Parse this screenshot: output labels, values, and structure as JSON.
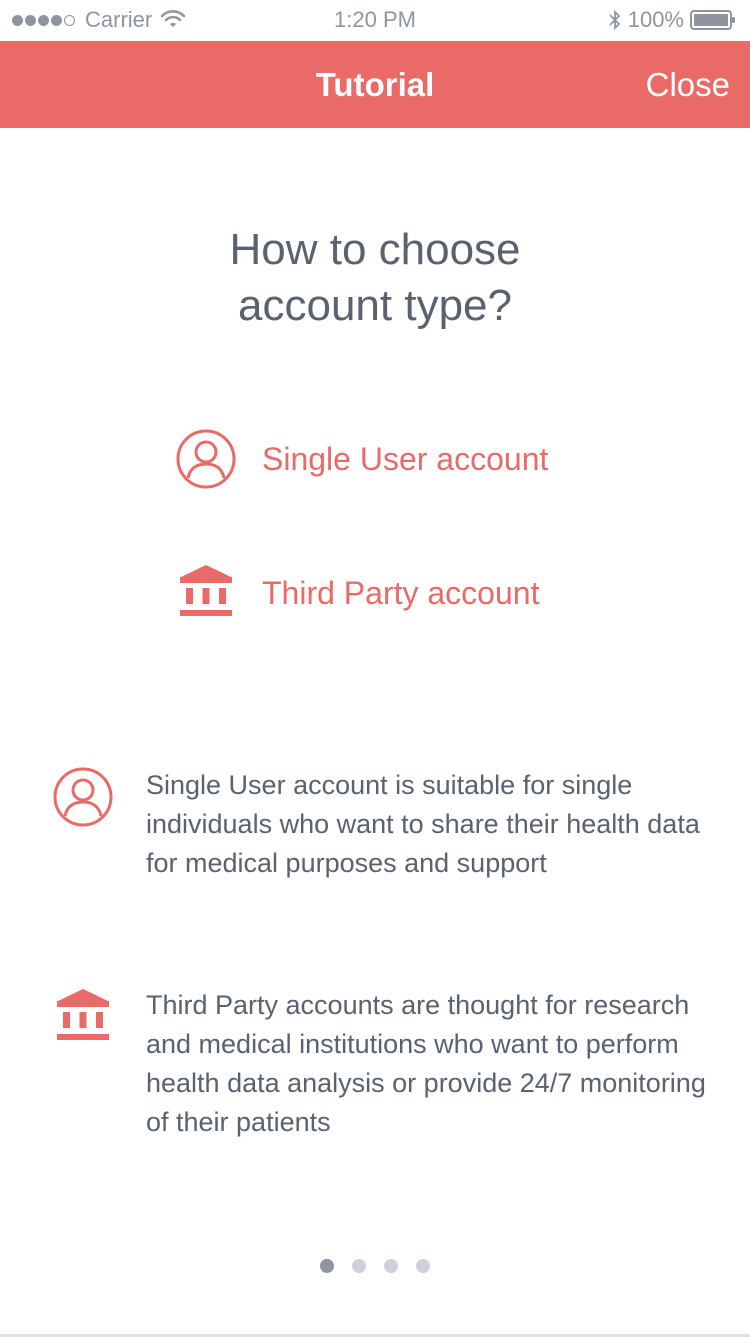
{
  "status_bar": {
    "carrier": "Carrier",
    "time": "1:20 PM",
    "battery": "100%"
  },
  "nav": {
    "title": "Tutorial",
    "close_label": "Close"
  },
  "heading": {
    "line1": "How to choose",
    "line2": "account type?"
  },
  "options": {
    "single_user": {
      "label": "Single User account",
      "icon": "user-circle-icon"
    },
    "third_party": {
      "label": "Third Party account",
      "icon": "institution-icon"
    }
  },
  "descriptions": {
    "single_user": "Single User account is suitable for single individuals who want to share their health data for medical purposes and support",
    "third_party": "Third Party accounts are thought for research and medical institutions who want to perform health data analysis or provide 24/7 monitoring of their patients"
  },
  "pager": {
    "total": 4,
    "active_index": 0
  },
  "colors": {
    "accent": "#e96a66",
    "text": "#5a6270",
    "muted": "#8f95a0"
  }
}
